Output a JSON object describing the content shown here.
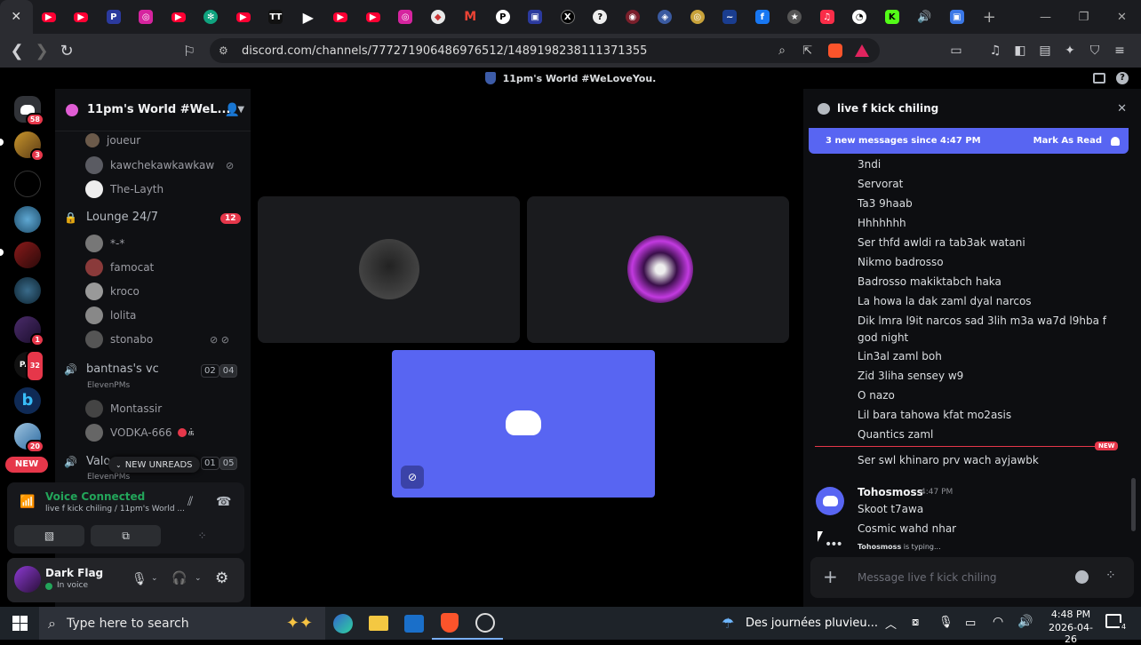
{
  "browser": {
    "url": "discord.com/channels/777271906486976512/1489198238111371355",
    "tab_favicons": [
      "close",
      "youtube",
      "youtube",
      "pinterest",
      "instagram",
      "youtube",
      "chatgpt",
      "youtube",
      "wattpad",
      "play",
      "youtube",
      "youtube",
      "instagram",
      "copilot",
      "gmail",
      "pi",
      "app",
      "x",
      "question",
      "target",
      "brave",
      "ring",
      "gov",
      "facebook",
      "badge",
      "music",
      "chat",
      "kick",
      "windows"
    ]
  },
  "discord": {
    "window_title": "11pm's World #WeLoveYou.",
    "server_name": "11pm's World #WeL...",
    "server_badges": [
      "58",
      "3",
      "1",
      "32",
      "20"
    ],
    "new_label": "NEW",
    "members_top": [
      "joueur",
      "kawchekawkawkaw",
      "The-Layth"
    ],
    "lounge": {
      "name": "Lounge 24/7",
      "badge": "12"
    },
    "lounge_members": [
      "*-*",
      "famocat",
      "kroco",
      "lolita",
      "stonabo"
    ],
    "bantnas": {
      "name": "bantnas's vc",
      "sub": "ElevenPMs",
      "count_a": "02",
      "count_b": "04"
    },
    "bantnas_members": [
      "Montassir",
      "VODKA-666"
    ],
    "vodka_tag": "க்",
    "valo": {
      "name": "Valo",
      "sub": "ElevenPMs",
      "count_a": "01",
      "count_b": "05"
    },
    "new_unreads": "NEW UNREADS",
    "voice": {
      "status": "Voice Connected",
      "channel": "live f kick chiling / 11pm's World ..."
    },
    "user": {
      "name": "Dark Flag",
      "status": "In voice"
    }
  },
  "chat": {
    "channel_name": "live f kick chiling",
    "banner_text": "3 new messages since 4:47 PM",
    "mark_read": "Mark As Read",
    "messages": [
      "3ndi",
      "Servorat",
      "Ta3 9haab",
      "Hhhhhhh",
      "Ser thfd awldi ra tab3ak watani",
      "Nikmo badrosso",
      "Badrosso makiktabch haka",
      "La howa la dak zaml dyal narcos",
      "Dik lmra l9it narcos sad 3lih m3a wa7d l9hba f",
      "god night",
      "Lin3al zaml boh",
      "Zid 3liha sensey w9",
      "O nazo",
      "Lil bara tahowa kfat mo2asis",
      "Quantics zaml"
    ],
    "new_tag": "NEW",
    "after_new": "Ser swl khinaro prv wach ayjawbk",
    "author": "Tohosmoss",
    "author_time": "4:47 PM",
    "author_msgs": [
      "Skoot t7awa",
      "Cosmic wahd nhar"
    ],
    "typing_user": "Tohosmoss",
    "typing_text": " is typing...",
    "input_placeholder": "Message live f kick chiling"
  },
  "taskbar": {
    "search_placeholder": "Type here to search",
    "weather": "Des journées pluvieu...",
    "time": "4:48 PM",
    "date": "2026-04-26",
    "notif_count": "4"
  },
  "colors": {
    "blurple": "#5865f2",
    "red": "#e6374a",
    "green": "#23a55a"
  }
}
